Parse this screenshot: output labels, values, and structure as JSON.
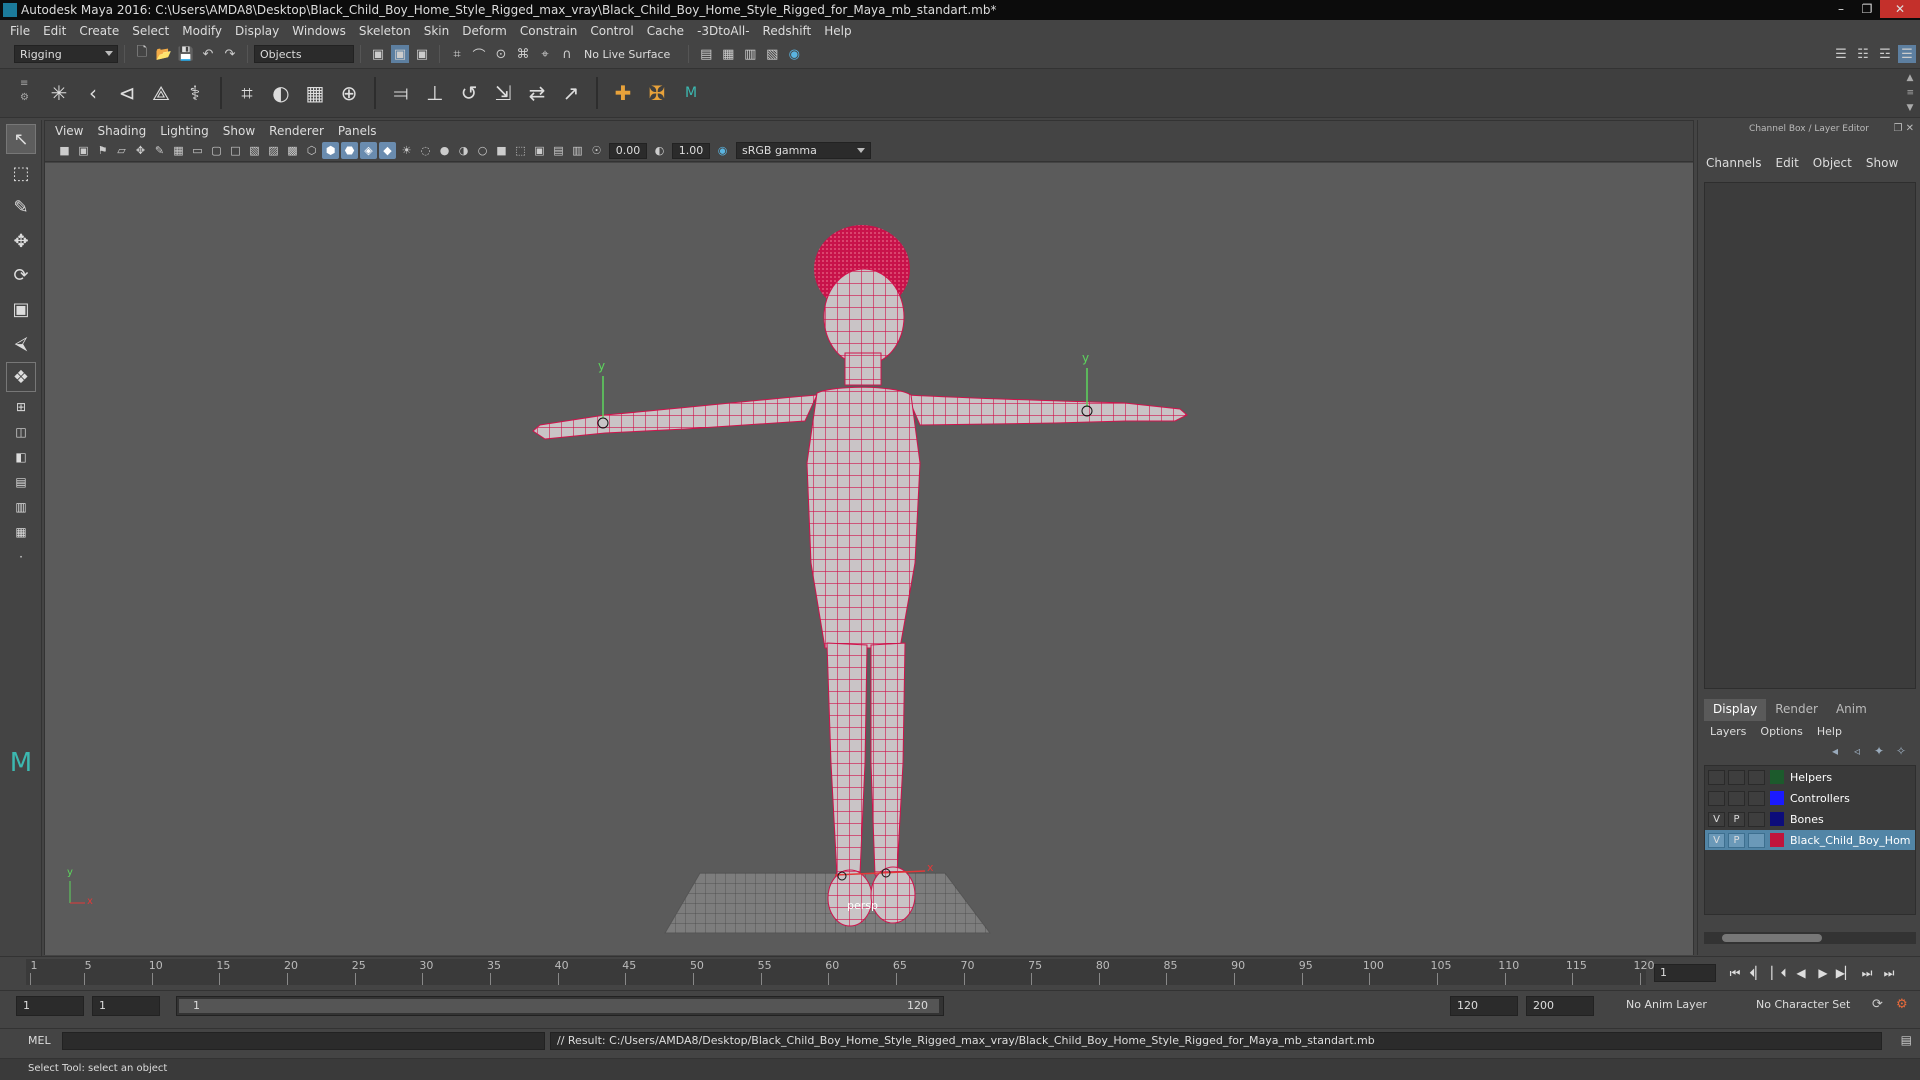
{
  "window": {
    "title": "Autodesk Maya 2016: C:\\Users\\AMDA8\\Desktop\\Black_Child_Boy_Home_Style_Rigged_max_vray\\Black_Child_Boy_Home_Style_Rigged_for_Maya_mb_standart.mb*"
  },
  "menubar": [
    "File",
    "Edit",
    "Create",
    "Select",
    "Modify",
    "Display",
    "Windows",
    "Skeleton",
    "Skin",
    "Deform",
    "Constrain",
    "Control",
    "Cache",
    "-3DtoAll-",
    "Redshift",
    "Help"
  ],
  "statusline": {
    "menuset": "Rigging",
    "selection_mode": "Objects",
    "live_surface": "No Live Surface"
  },
  "viewport": {
    "menu": [
      "View",
      "Shading",
      "Lighting",
      "Show",
      "Renderer",
      "Panels"
    ],
    "exposure": "0.00",
    "gamma_value": "1.00",
    "color_space": "sRGB gamma",
    "camera": "persp",
    "axis_y_label": "y",
    "axis_x_label": "x"
  },
  "timeline": {
    "tick_labels": [
      "1",
      "5",
      "10",
      "15",
      "20",
      "25",
      "30",
      "35",
      "40",
      "45",
      "50",
      "55",
      "60",
      "65",
      "70",
      "75",
      "80",
      "85",
      "90",
      "95",
      "100",
      "105",
      "110",
      "115",
      "120"
    ],
    "current_frame": "1",
    "range_start": "1",
    "playback_start": "1",
    "slider_start": "1",
    "slider_end": "120",
    "playback_end": "120",
    "range_end": "200",
    "anim_layer": "No Anim Layer",
    "character_set": "No Character Set"
  },
  "command_line": {
    "mode": "MEL",
    "result": "// Result: C:/Users/AMDA8/Desktop/Black_Child_Boy_Home_Style_Rigged_max_vray/Black_Child_Boy_Home_Style_Rigged_for_Maya_mb_standart.mb"
  },
  "help_line": "Select Tool: select an object",
  "channel_box": {
    "title": "Channel Box / Layer Editor",
    "menu": [
      "Channels",
      "Edit",
      "Object",
      "Show"
    ]
  },
  "layer_editor": {
    "tabs": [
      "Display",
      "Render",
      "Anim"
    ],
    "active_tab": "Display",
    "menu": [
      "Layers",
      "Options",
      "Help"
    ],
    "layers": [
      {
        "v": "",
        "p": "",
        "color": "#1c5a2c",
        "name": "Helpers",
        "selected": false
      },
      {
        "v": "",
        "p": "",
        "color": "#1a1aff",
        "name": "Controllers",
        "selected": false
      },
      {
        "v": "V",
        "p": "P",
        "color": "#0c0c7a",
        "name": "Bones",
        "selected": false
      },
      {
        "v": "V",
        "p": "P",
        "color": "#c0143c",
        "name": "Black_Child_Boy_Hom",
        "selected": true
      }
    ]
  },
  "colors": {
    "wireframe": "#d0134c",
    "viewport_bg": "#5b5b5b",
    "selection": "#5285a6"
  }
}
